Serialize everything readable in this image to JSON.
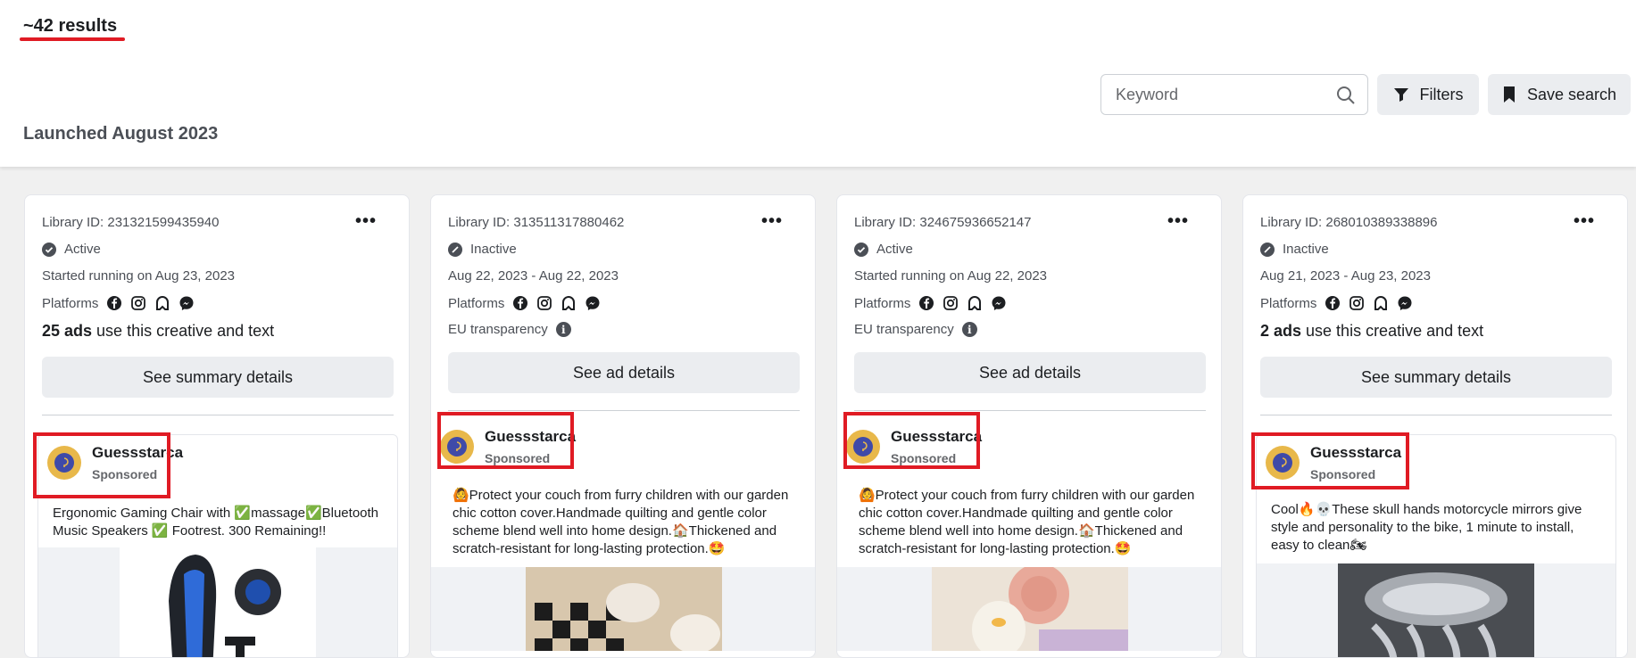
{
  "header": {
    "results": "~42 results",
    "launched": "Launched August 2023",
    "keyword_placeholder": "Keyword",
    "filters_label": "Filters",
    "save_search_label": "Save search"
  },
  "cards": [
    {
      "library_id": "Library ID: 231321599435940",
      "status": "Active",
      "dates": "Started running on Aug 23, 2023",
      "platforms_label": "Platforms",
      "uses_count": "25 ads",
      "uses_text": " use this creative and text",
      "button": "See summary details",
      "page_name": "Guessstarca",
      "sponsored": "Sponsored",
      "ad_text": "Ergonomic Gaming Chair with ✅massage✅Bluetooth Music Speakers ✅ Footrest. 300 Remaining!!"
    },
    {
      "library_id": "Library ID: 313511317880462",
      "status": "Inactive",
      "dates": "Aug 22, 2023 - Aug 22, 2023",
      "platforms_label": "Platforms",
      "eu_label": "EU transparency",
      "button": "See ad details",
      "page_name": "Guessstarca",
      "sponsored": "Sponsored",
      "ad_text": "🙆Protect your couch from furry children with our garden chic cotton cover.Handmade quilting and gentle color scheme blend well into home design.🏠Thickened and scratch-resistant for long-lasting protection.🤩"
    },
    {
      "library_id": "Library ID: 324675936652147",
      "status": "Active",
      "dates": "Started running on Aug 22, 2023",
      "platforms_label": "Platforms",
      "eu_label": "EU transparency",
      "button": "See ad details",
      "page_name": "Guessstarca",
      "sponsored": "Sponsored",
      "ad_text": "🙆Protect your couch from furry children with our garden chic cotton cover.Handmade quilting and gentle color scheme blend well into home design.🏠Thickened and scratch-resistant for long-lasting protection.🤩"
    },
    {
      "library_id": "Library ID: 268010389338896",
      "status": "Inactive",
      "dates": "Aug 21, 2023 - Aug 23, 2023",
      "platforms_label": "Platforms",
      "uses_count": "2 ads",
      "uses_text": " use this creative and text",
      "button": "See summary details",
      "page_name": "Guessstarca",
      "sponsored": "Sponsored",
      "ad_text": "Cool🔥💀These skull hands motorcycle mirrors give style and personality to the bike, 1 minute to install, easy to clean🏍"
    }
  ],
  "colors": {
    "highlight": "#e01b24",
    "button_bg": "#ebedf0",
    "avatar": "#e8b84a"
  },
  "icons": [
    "search-icon",
    "filter-icon",
    "bookmark-icon",
    "more-icon",
    "check-icon",
    "inactive-icon",
    "facebook-icon",
    "instagram-icon",
    "audience-network-icon",
    "messenger-icon",
    "info-icon"
  ]
}
